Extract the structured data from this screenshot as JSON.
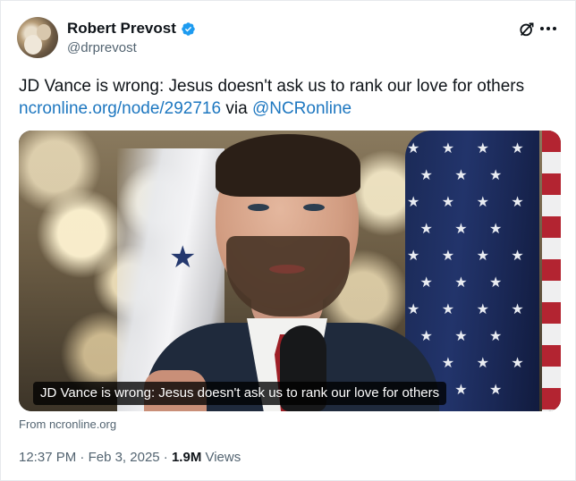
{
  "author": {
    "display_name": "Robert Prevost",
    "handle": "@drprevost",
    "verified": true,
    "verified_color": "#1d9bf0"
  },
  "tweet": {
    "text": "JD Vance is wrong: Jesus doesn't ask us to rank our love for others",
    "link_url_text": "ncronline.org/node/292716",
    "via_text": " via ",
    "mention": "@NCRonline",
    "link_color": "#1d77c0"
  },
  "media": {
    "caption": "JD Vance is wrong: Jesus doesn't ask us to rank our love for others",
    "source": "From ncronline.org"
  },
  "meta": {
    "time": "12:37 PM",
    "separator": " · ",
    "date": "Feb 3, 2025",
    "views_count": "1.9M",
    "views_label": " Views"
  },
  "icons": {
    "grok": "grok-icon",
    "more": "more-icon",
    "verified": "verified-badge-icon"
  }
}
